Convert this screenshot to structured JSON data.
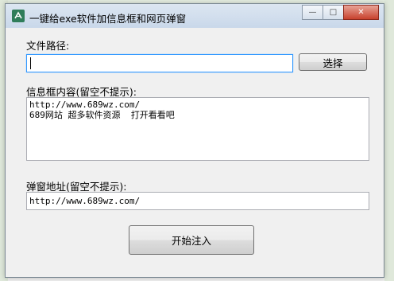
{
  "window": {
    "title": "一键给exe软件加信息框和网页弹窗",
    "minimize_symbol": "—",
    "maximize_symbol": "□",
    "close_symbol": "✕"
  },
  "file_path": {
    "label": "文件路径:",
    "value": "",
    "browse_label": "选择"
  },
  "info_box": {
    "label": "信息框内容(留空不提示):",
    "value": "http://www.689wz.com/\n689网站 超多软件资源  打开看看吧"
  },
  "popup_url": {
    "label": "弹窗地址(留空不提示):",
    "value": "http://www.689wz.com/"
  },
  "start_button_label": "开始注入",
  "colors": {
    "title_gradient_top": "#dce6f1",
    "close_button": "#c7412d",
    "focus_border": "#3399ff"
  }
}
